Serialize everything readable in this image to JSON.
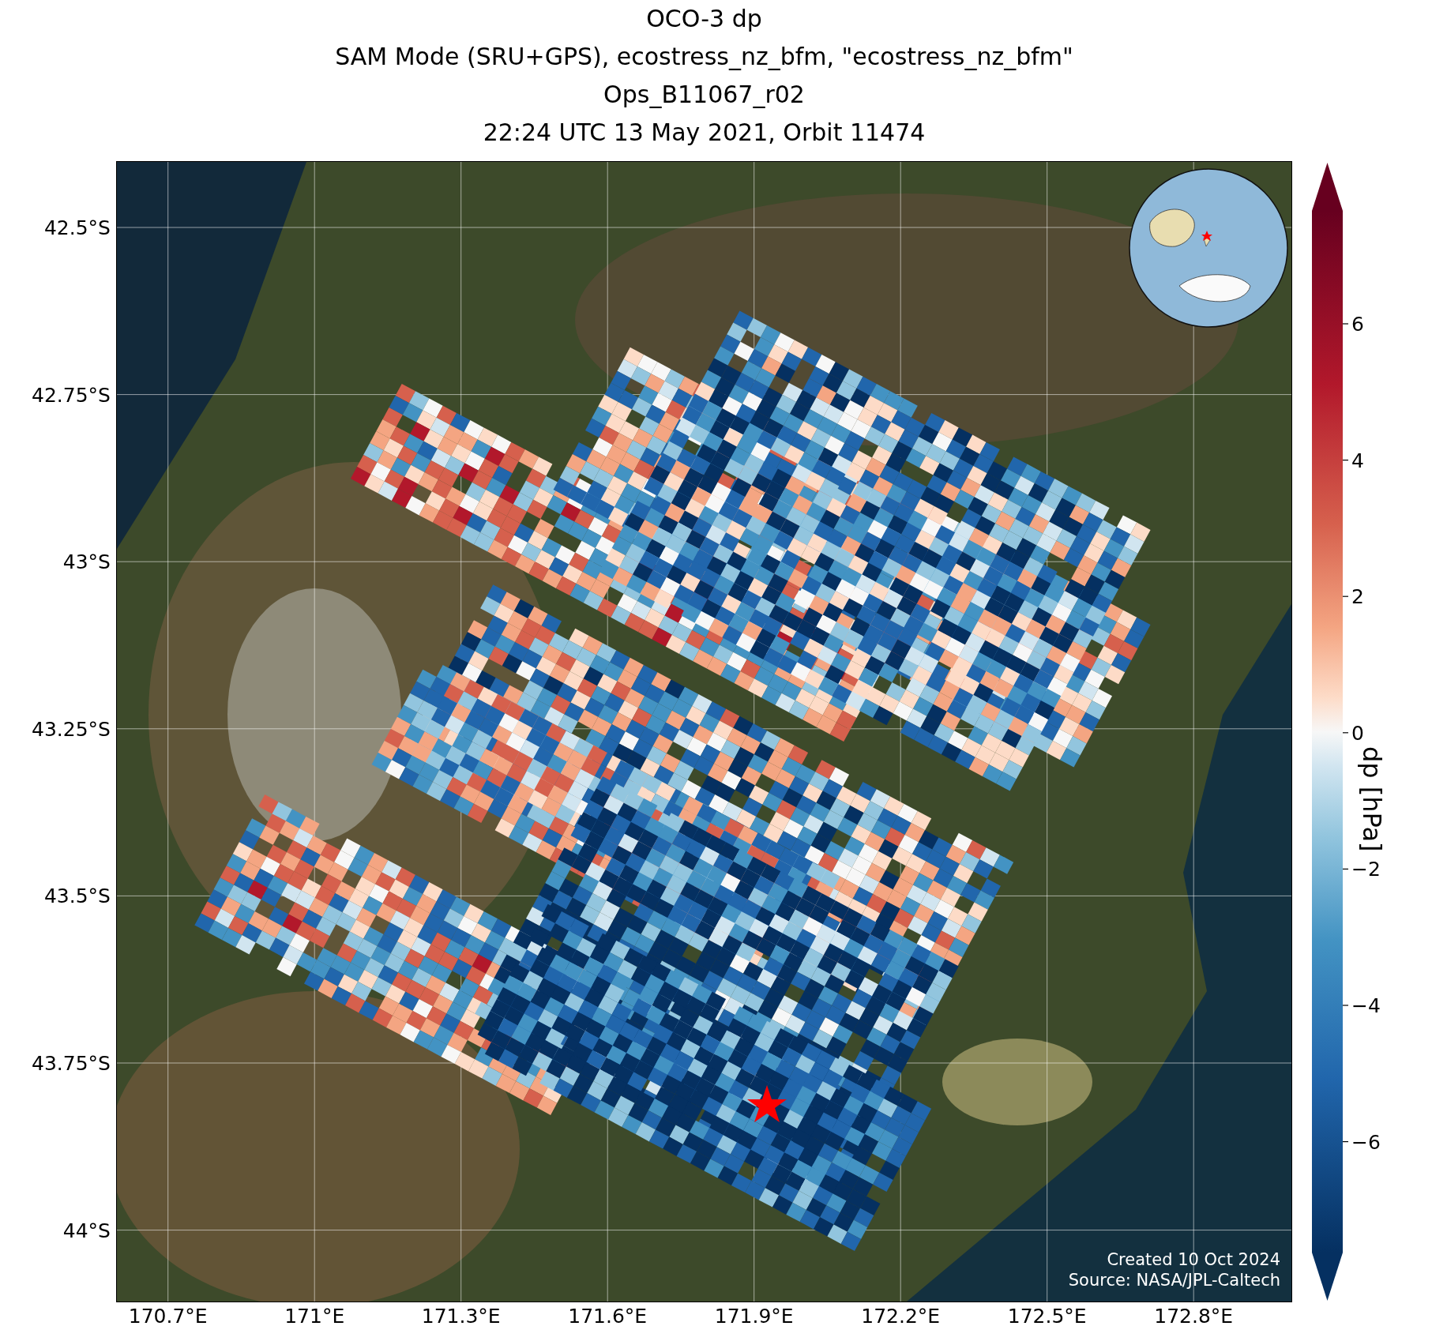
{
  "title_lines": [
    "OCO-3 dp",
    "SAM Mode (SRU+GPS), ecostress_nz_bfm, \"ecostress_nz_bfm\"",
    "Ops_B11067_r02",
    "22:24 UTC 13 May 2021, Orbit 11474"
  ],
  "map": {
    "lat_ticks": [
      "42.5°S",
      "42.75°S",
      "43°S",
      "43.25°S",
      "43.5°S",
      "43.75°S",
      "44°S"
    ],
    "lon_ticks": [
      "170.7°E",
      "171°E",
      "171.3°E",
      "171.6°E",
      "171.9°E",
      "172.2°E",
      "172.5°E",
      "172.8°E"
    ],
    "credits": [
      "Created 10 Oct 2024",
      "Source: NASA/JPL-Caltech"
    ]
  },
  "colorbar": {
    "label": "dp [hPa]",
    "ticks": [
      "6",
      "4",
      "2",
      "0",
      "−2",
      "−4",
      "−6"
    ]
  }
}
